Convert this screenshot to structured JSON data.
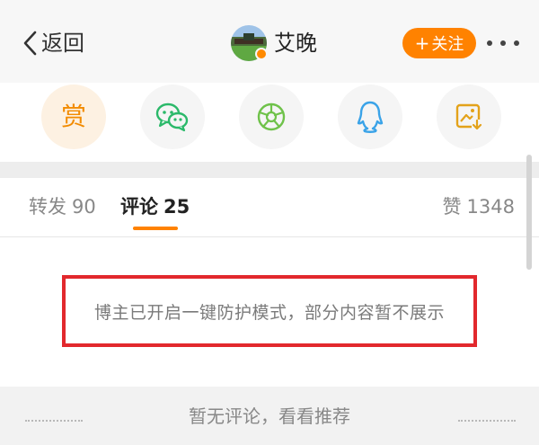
{
  "topbar": {
    "back_label": "返回",
    "back_icon": "chevron-left-icon",
    "username": "艾晚",
    "follow_plus": "+",
    "follow_label": "关注",
    "more_icon": "more-dots-icon"
  },
  "share": {
    "reward_label": "赏",
    "items": [
      "reward-icon",
      "wechat-icon",
      "moments-icon",
      "qq-icon",
      "save-image-icon"
    ]
  },
  "tabs": {
    "repost_label": "转发",
    "repost_count": "90",
    "comment_label": "评论",
    "comment_count": "25",
    "like_label": "赞",
    "like_count": "1348"
  },
  "notice": {
    "text": "博主已开启一键防护模式，部分内容暂不展示"
  },
  "bottom": {
    "text": "暂无评论，看看推荐"
  },
  "colors": {
    "accent": "#ff8200",
    "highlight_border": "#e2282d",
    "wechat_green": "#2bb96a",
    "moments_green": "#6fc24a",
    "qq_blue": "#3aa3e8",
    "reward_orange": "#f28b00"
  }
}
